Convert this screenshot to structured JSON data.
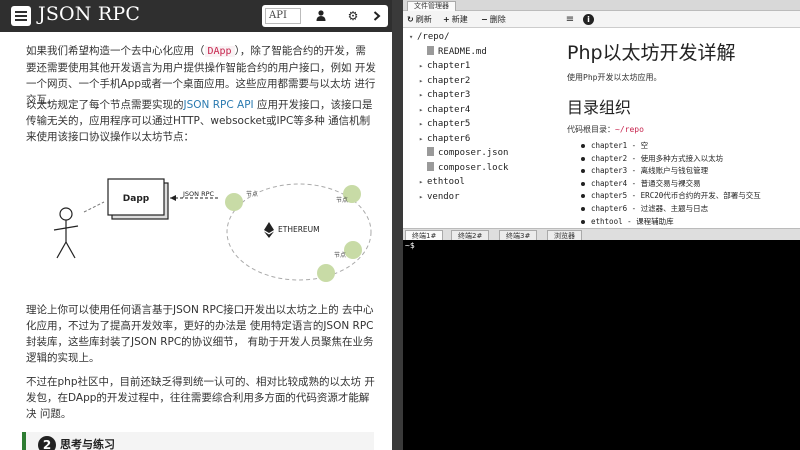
{
  "doc": {
    "title": "JSON RPC",
    "search": {
      "value": "API"
    },
    "icons": [
      "bars-icon",
      "user-icon",
      "gear-icon",
      "chevron-right-icon"
    ],
    "p1": {
      "before": "如果我们希望构造一个去中心化应用（",
      "code": "DApp",
      "after": "），除了智能合约的开发，需要还需要使用其他开发语言为用户提供操作智能合约的用户接口，例如 开发一个网页、一个手机App或者一个桌面应用。这些应用都需要与以太坊 进行交互。"
    },
    "p2": {
      "before": "以太坊规定了每个节点需要实现的",
      "link": "JSON RPC API",
      "after": " 应用开发接口，该接口是传输无关的，应用程序可以通过HTTP、websocket或IPC等多种 通信机制来使用该接口协议操作以太坊节点："
    },
    "diagram": {
      "dapp": "Dapp",
      "arrow_label": "JSON RPC",
      "ethereum": "ETHEREUM",
      "node": "节点"
    },
    "p3": "理论上你可以使用任何语言基于JSON RPC接口开发出以太坊之上的 去中心化应用，不过为了提高开发效率，更好的办法是 使用特定语言的JSON RPC封装库，这些库封装了JSON RPC的协议细节， 有助于开发人员聚焦在业务逻辑的实现上。",
    "p4": "不过在php社区中，目前还缺乏得到统一认可的、相对比较成熟的以太坊 开发包，在DApp的开发过程中，往往需要综合利用多方面的代码资源才能解决 问题。",
    "exercise": {
      "num": "2",
      "label": "思考与练习"
    }
  },
  "ide": {
    "file_manager_tab": "文件管理器",
    "toolbar": {
      "refresh": "刷新",
      "new": "新建",
      "delete": "删除"
    },
    "tree": [
      {
        "name": "/repo/",
        "kind": "root"
      },
      {
        "name": "README.md",
        "kind": "file"
      },
      {
        "name": "chapter1",
        "kind": "dir"
      },
      {
        "name": "chapter2",
        "kind": "dir"
      },
      {
        "name": "chapter3",
        "kind": "dir"
      },
      {
        "name": "chapter4",
        "kind": "dir"
      },
      {
        "name": "chapter5",
        "kind": "dir"
      },
      {
        "name": "chapter6",
        "kind": "dir"
      },
      {
        "name": "composer.json",
        "kind": "file"
      },
      {
        "name": "composer.lock",
        "kind": "file"
      },
      {
        "name": "ethtool",
        "kind": "dir"
      },
      {
        "name": "vendor",
        "kind": "dir"
      }
    ],
    "preview": {
      "h1": "Php以太坊开发详解",
      "sub": "使用Php开发以太坊应用。",
      "h2": "目录组织",
      "root_label": "代码根目录：",
      "root_code": "~/repo",
      "items": [
        "chapter1 - 空",
        "chapter2 - 使用多种方式接入以太坊",
        "chapter3 - 离线账户与钱包管理",
        "chapter4 - 普通交易与裸交易",
        "chapter5 - ERC20代币合约的开发、部署与交互",
        "chapter6 - 过滤器、主题与日志",
        "ethtool - 课程辅助库"
      ]
    },
    "terminal_tabs": [
      "终端1#",
      "终端2#",
      "终端3#",
      "浏览器"
    ],
    "terminal_prompt": "~$"
  }
}
